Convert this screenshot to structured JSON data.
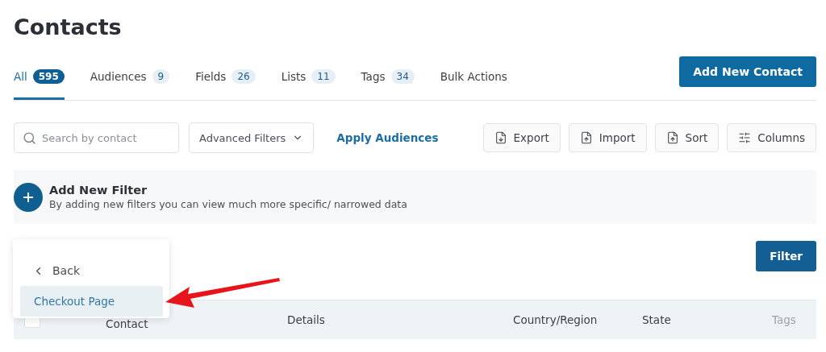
{
  "title": "Contacts",
  "tabs": [
    {
      "label": "All",
      "count": "595",
      "selected": true
    },
    {
      "label": "Audiences",
      "count": "9",
      "selected": false
    },
    {
      "label": "Fields",
      "count": "26",
      "selected": false
    },
    {
      "label": "Lists",
      "count": "11",
      "selected": false
    },
    {
      "label": "Tags",
      "count": "34",
      "selected": false
    },
    {
      "label": "Bulk Actions",
      "selected": false
    }
  ],
  "add_button": "Add New Contact",
  "search": {
    "placeholder": "Search by contact"
  },
  "advanced_filters": "Advanced Filters",
  "apply_audiences": "Apply Audiences",
  "tool_buttons": [
    {
      "label": "Export",
      "kind": "export"
    },
    {
      "label": "Import",
      "kind": "import"
    },
    {
      "label": "Sort",
      "kind": "sort"
    },
    {
      "label": "Columns",
      "kind": "columns"
    }
  ],
  "filter_panel": {
    "title": "Add New Filter",
    "description": "By adding new filters you can view much more specific/ narrowed data"
  },
  "filter_button": "Filter",
  "dropdown": {
    "back": "Back",
    "items": [
      {
        "label": "Checkout Page",
        "selected": true
      }
    ]
  },
  "table": {
    "select_all": {
      "checked": false
    },
    "columns": [
      "Contact",
      "Details",
      "Country/Region",
      "State",
      "Tags"
    ]
  }
}
